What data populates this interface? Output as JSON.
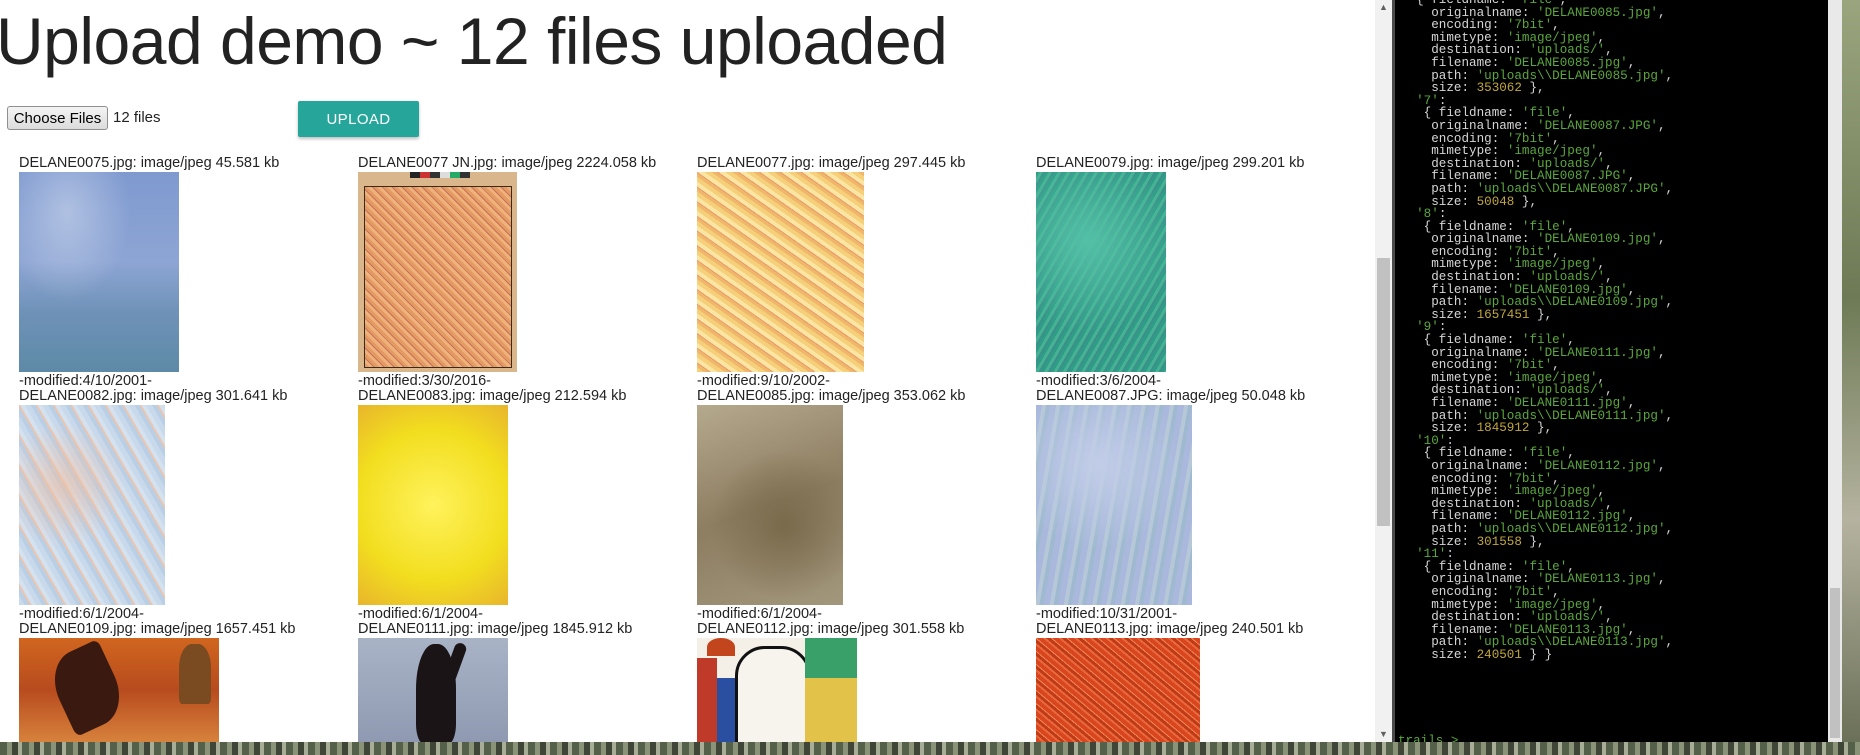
{
  "page": {
    "title": "Upload demo ~ 12 files uploaded"
  },
  "upload_form": {
    "choose_files_label": "Choose Files",
    "files_selected": "12 files",
    "upload_label": "UPLOAD"
  },
  "files": [
    {
      "caption_top": "DELANE0075.jpg: image/jpeg 45.581 kb",
      "caption_bottom": "-modified:4/10/2001-"
    },
    {
      "caption_top": "DELANE0077 JN.jpg: image/jpeg 2224.058 kb",
      "caption_bottom": "-modified:3/30/2016-"
    },
    {
      "caption_top": "DELANE0077.jpg: image/jpeg 297.445 kb",
      "caption_bottom": "-modified:9/10/2002-"
    },
    {
      "caption_top": "DELANE0079.jpg: image/jpeg 299.201 kb",
      "caption_bottom": "-modified:3/6/2004-"
    },
    {
      "caption_top": "DELANE0082.jpg: image/jpeg 301.641 kb",
      "caption_bottom": "-modified:6/1/2004-"
    },
    {
      "caption_top": "DELANE0083.jpg: image/jpeg 212.594 kb",
      "caption_bottom": "-modified:6/1/2004-"
    },
    {
      "caption_top": "DELANE0085.jpg: image/jpeg 353.062 kb",
      "caption_bottom": "-modified:6/1/2004-"
    },
    {
      "caption_top": "DELANE0087.JPG: image/jpeg 50.048 kb",
      "caption_bottom": "-modified:10/31/2001-"
    },
    {
      "caption_top": "DELANE0109.jpg: image/jpeg 1657.451 kb",
      "caption_bottom": ""
    },
    {
      "caption_top": "DELANE0111.jpg: image/jpeg 1845.912 kb",
      "caption_bottom": ""
    },
    {
      "caption_top": "DELANE0112.jpg: image/jpeg 301.558 kb",
      "caption_bottom": ""
    },
    {
      "caption_top": "DELANE0113.jpg: image/jpeg 240.501 kb",
      "caption_bottom": ""
    }
  ],
  "terminal": {
    "lines": [
      [
        [
          "  { fieldname: ",
          "t"
        ],
        [
          "'file'",
          "s"
        ],
        [
          ",",
          "t"
        ]
      ],
      [
        [
          "    originalname: ",
          "t"
        ],
        [
          "'DELANE0085.jpg'",
          "s"
        ],
        [
          ",",
          "t"
        ]
      ],
      [
        [
          "    encoding: ",
          "t"
        ],
        [
          "'7bit'",
          "s"
        ],
        [
          ",",
          "t"
        ]
      ],
      [
        [
          "    mimetype: ",
          "t"
        ],
        [
          "'image/jpeg'",
          "s"
        ],
        [
          ",",
          "t"
        ]
      ],
      [
        [
          "    destination: ",
          "t"
        ],
        [
          "'uploads/'",
          "s"
        ],
        [
          ",",
          "t"
        ]
      ],
      [
        [
          "    filename: ",
          "t"
        ],
        [
          "'DELANE0085.jpg'",
          "s"
        ],
        [
          ",",
          "t"
        ]
      ],
      [
        [
          "    path: ",
          "t"
        ],
        [
          "'uploads\\\\DELANE0085.jpg'",
          "s"
        ],
        [
          ",",
          "t"
        ]
      ],
      [
        [
          "    size: ",
          "t"
        ],
        [
          "353062",
          "n"
        ],
        [
          " },",
          "t"
        ]
      ],
      [
        [
          "  ",
          "t"
        ],
        [
          "'7'",
          "s"
        ],
        [
          ":",
          "t"
        ]
      ],
      [
        [
          "   { fieldname: ",
          "t"
        ],
        [
          "'file'",
          "s"
        ],
        [
          ",",
          "t"
        ]
      ],
      [
        [
          "    originalname: ",
          "t"
        ],
        [
          "'DELANE0087.JPG'",
          "s"
        ],
        [
          ",",
          "t"
        ]
      ],
      [
        [
          "    encoding: ",
          "t"
        ],
        [
          "'7bit'",
          "s"
        ],
        [
          ",",
          "t"
        ]
      ],
      [
        [
          "    mimetype: ",
          "t"
        ],
        [
          "'image/jpeg'",
          "s"
        ],
        [
          ",",
          "t"
        ]
      ],
      [
        [
          "    destination: ",
          "t"
        ],
        [
          "'uploads/'",
          "s"
        ],
        [
          ",",
          "t"
        ]
      ],
      [
        [
          "    filename: ",
          "t"
        ],
        [
          "'DELANE0087.JPG'",
          "s"
        ],
        [
          ",",
          "t"
        ]
      ],
      [
        [
          "    path: ",
          "t"
        ],
        [
          "'uploads\\\\DELANE0087.JPG'",
          "s"
        ],
        [
          ",",
          "t"
        ]
      ],
      [
        [
          "    size: ",
          "t"
        ],
        [
          "50048",
          "n"
        ],
        [
          " },",
          "t"
        ]
      ],
      [
        [
          "  ",
          "t"
        ],
        [
          "'8'",
          "s"
        ],
        [
          ":",
          "t"
        ]
      ],
      [
        [
          "   { fieldname: ",
          "t"
        ],
        [
          "'file'",
          "s"
        ],
        [
          ",",
          "t"
        ]
      ],
      [
        [
          "    originalname: ",
          "t"
        ],
        [
          "'DELANE0109.jpg'",
          "s"
        ],
        [
          ",",
          "t"
        ]
      ],
      [
        [
          "    encoding: ",
          "t"
        ],
        [
          "'7bit'",
          "s"
        ],
        [
          ",",
          "t"
        ]
      ],
      [
        [
          "    mimetype: ",
          "t"
        ],
        [
          "'image/jpeg'",
          "s"
        ],
        [
          ",",
          "t"
        ]
      ],
      [
        [
          "    destination: ",
          "t"
        ],
        [
          "'uploads/'",
          "s"
        ],
        [
          ",",
          "t"
        ]
      ],
      [
        [
          "    filename: ",
          "t"
        ],
        [
          "'DELANE0109.jpg'",
          "s"
        ],
        [
          ",",
          "t"
        ]
      ],
      [
        [
          "    path: ",
          "t"
        ],
        [
          "'uploads\\\\DELANE0109.jpg'",
          "s"
        ],
        [
          ",",
          "t"
        ]
      ],
      [
        [
          "    size: ",
          "t"
        ],
        [
          "1657451",
          "n"
        ],
        [
          " },",
          "t"
        ]
      ],
      [
        [
          "  ",
          "t"
        ],
        [
          "'9'",
          "s"
        ],
        [
          ":",
          "t"
        ]
      ],
      [
        [
          "   { fieldname: ",
          "t"
        ],
        [
          "'file'",
          "s"
        ],
        [
          ",",
          "t"
        ]
      ],
      [
        [
          "    originalname: ",
          "t"
        ],
        [
          "'DELANE0111.jpg'",
          "s"
        ],
        [
          ",",
          "t"
        ]
      ],
      [
        [
          "    encoding: ",
          "t"
        ],
        [
          "'7bit'",
          "s"
        ],
        [
          ",",
          "t"
        ]
      ],
      [
        [
          "    mimetype: ",
          "t"
        ],
        [
          "'image/jpeg'",
          "s"
        ],
        [
          ",",
          "t"
        ]
      ],
      [
        [
          "    destination: ",
          "t"
        ],
        [
          "'uploads/'",
          "s"
        ],
        [
          ",",
          "t"
        ]
      ],
      [
        [
          "    filename: ",
          "t"
        ],
        [
          "'DELANE0111.jpg'",
          "s"
        ],
        [
          ",",
          "t"
        ]
      ],
      [
        [
          "    path: ",
          "t"
        ],
        [
          "'uploads\\\\DELANE0111.jpg'",
          "s"
        ],
        [
          ",",
          "t"
        ]
      ],
      [
        [
          "    size: ",
          "t"
        ],
        [
          "1845912",
          "n"
        ],
        [
          " },",
          "t"
        ]
      ],
      [
        [
          "  ",
          "t"
        ],
        [
          "'10'",
          "s"
        ],
        [
          ":",
          "t"
        ]
      ],
      [
        [
          "   { fieldname: ",
          "t"
        ],
        [
          "'file'",
          "s"
        ],
        [
          ",",
          "t"
        ]
      ],
      [
        [
          "    originalname: ",
          "t"
        ],
        [
          "'DELANE0112.jpg'",
          "s"
        ],
        [
          ",",
          "t"
        ]
      ],
      [
        [
          "    encoding: ",
          "t"
        ],
        [
          "'7bit'",
          "s"
        ],
        [
          ",",
          "t"
        ]
      ],
      [
        [
          "    mimetype: ",
          "t"
        ],
        [
          "'image/jpeg'",
          "s"
        ],
        [
          ",",
          "t"
        ]
      ],
      [
        [
          "    destination: ",
          "t"
        ],
        [
          "'uploads/'",
          "s"
        ],
        [
          ",",
          "t"
        ]
      ],
      [
        [
          "    filename: ",
          "t"
        ],
        [
          "'DELANE0112.jpg'",
          "s"
        ],
        [
          ",",
          "t"
        ]
      ],
      [
        [
          "    path: ",
          "t"
        ],
        [
          "'uploads\\\\DELANE0112.jpg'",
          "s"
        ],
        [
          ",",
          "t"
        ]
      ],
      [
        [
          "    size: ",
          "t"
        ],
        [
          "301558",
          "n"
        ],
        [
          " },",
          "t"
        ]
      ],
      [
        [
          "  ",
          "t"
        ],
        [
          "'11'",
          "s"
        ],
        [
          ":",
          "t"
        ]
      ],
      [
        [
          "   { fieldname: ",
          "t"
        ],
        [
          "'file'",
          "s"
        ],
        [
          ",",
          "t"
        ]
      ],
      [
        [
          "    originalname: ",
          "t"
        ],
        [
          "'DELANE0113.jpg'",
          "s"
        ],
        [
          ",",
          "t"
        ]
      ],
      [
        [
          "    encoding: ",
          "t"
        ],
        [
          "'7bit'",
          "s"
        ],
        [
          ",",
          "t"
        ]
      ],
      [
        [
          "    mimetype: ",
          "t"
        ],
        [
          "'image/jpeg'",
          "s"
        ],
        [
          ",",
          "t"
        ]
      ],
      [
        [
          "    destination: ",
          "t"
        ],
        [
          "'uploads/'",
          "s"
        ],
        [
          ",",
          "t"
        ]
      ],
      [
        [
          "    filename: ",
          "t"
        ],
        [
          "'DELANE0113.jpg'",
          "s"
        ],
        [
          ",",
          "t"
        ]
      ],
      [
        [
          "    path: ",
          "t"
        ],
        [
          "'uploads\\\\DELANE0113.jpg'",
          "s"
        ],
        [
          ",",
          "t"
        ]
      ],
      [
        [
          "    size: ",
          "t"
        ],
        [
          "240501",
          "n"
        ],
        [
          " } }",
          "t"
        ]
      ]
    ],
    "prompt": "trails >"
  },
  "colors": {
    "accent": "#26a69a",
    "terminal_bg": "#000000",
    "terminal_string": "#5aa83c",
    "terminal_number": "#c0a63d"
  }
}
